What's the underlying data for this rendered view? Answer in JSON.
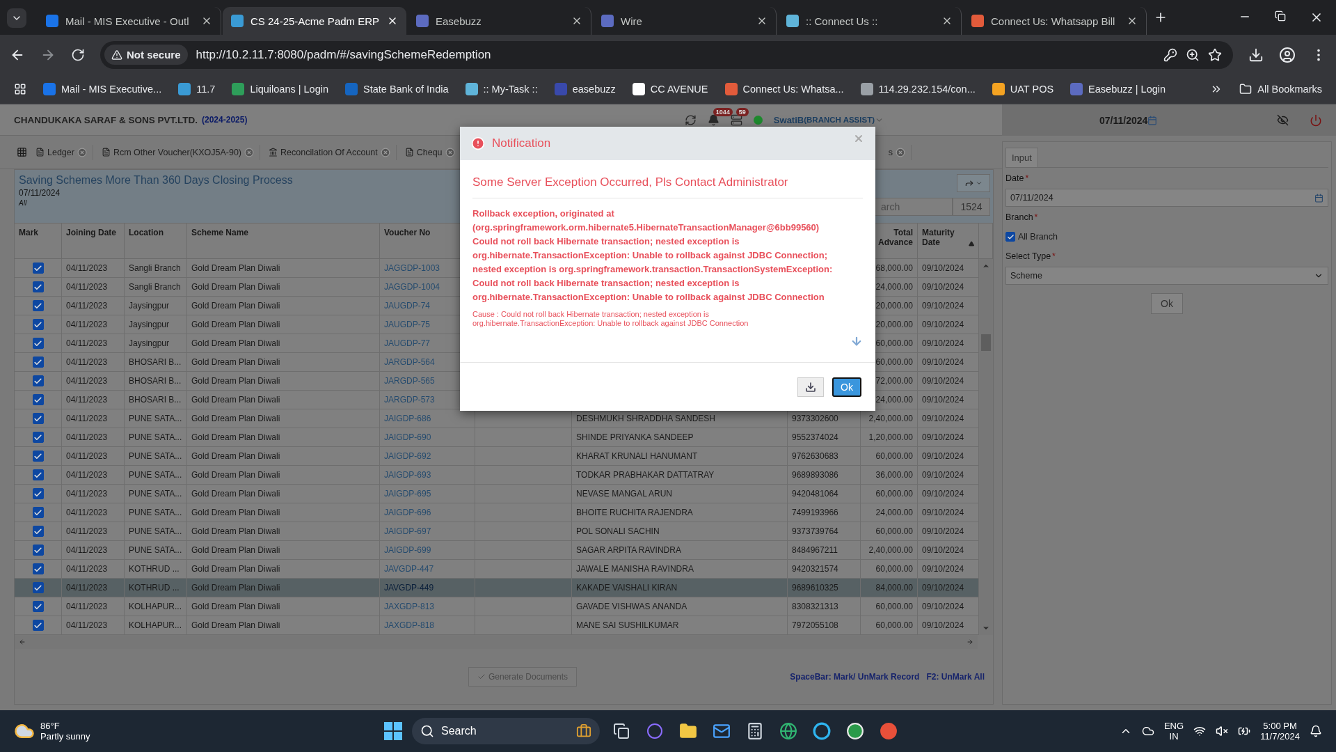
{
  "browser": {
    "tabs": [
      {
        "title": "Mail - MIS Executive - Outl",
        "selected": false
      },
      {
        "title": "CS 24-25-Acme Padm ERP",
        "selected": true
      },
      {
        "title": "Easebuzz",
        "selected": false
      },
      {
        "title": "Wire",
        "selected": false
      },
      {
        "title": ":: Connect Us ::",
        "selected": false
      },
      {
        "title": "Connect Us: Whatsapp Bill",
        "selected": false
      }
    ],
    "security": "Not secure",
    "url": "http://10.2.11.7:8080/padm/#/savingSchemeRedemption",
    "bookmarks": [
      {
        "label": "Mail - MIS Executive...",
        "color": "#1a73e8"
      },
      {
        "label": "11.7",
        "color": "#3a9bd5"
      },
      {
        "label": "Liquiloans | Login",
        "color": "#2e9e5a"
      },
      {
        "label": "State Bank of India",
        "color": "#1565c0"
      },
      {
        "label": ":: My-Task ::",
        "color": "#5fb4d9"
      },
      {
        "label": "easebuzz",
        "color": "#3949ab"
      },
      {
        "label": "CC AVENUE",
        "color": "#ffffff"
      },
      {
        "label": "Connect Us: Whatsa...",
        "color": "#e25b3b"
      },
      {
        "label": "114.29.232.154/con...",
        "color": "#9aa0a6"
      },
      {
        "label": "UAT POS",
        "color": "#f4a322"
      },
      {
        "label": "Easebuzz | Login",
        "color": "#5c6bc0"
      }
    ],
    "all_bookmarks": "All Bookmarks"
  },
  "header": {
    "company": "CHANDUKAKA SARAF & SONS PVT.LTD.",
    "year": "(2024-2025)",
    "notifications": "1044",
    "messages": "59",
    "user": "SwatiB",
    "role": "(BRANCH ASSIST)",
    "date": "07/11/2024"
  },
  "tabs": [
    {
      "label": "Ledger"
    },
    {
      "label": "Rcm Other Voucher(KXOJ5A-90)"
    },
    {
      "label": "Reconcilation Of Account"
    },
    {
      "label": "Chequ"
    },
    {
      "label": "s"
    }
  ],
  "panel": {
    "title": "Saving Schemes More Than 360 Days Closing Process",
    "date": "07/11/2024",
    "filter": "All",
    "search_placeholder": "arch",
    "count": "1524"
  },
  "table": {
    "columns": [
      "Mark",
      "Joining Date",
      "Location",
      "Scheme Name",
      "Voucher No",
      "Total Advance",
      "Maturity Date"
    ],
    "rows": [
      {
        "date": "04/11/2023",
        "location": "Sangli Branch",
        "scheme": "Gold Dream Plan Diwali",
        "voucher": "JAGGDP-1003",
        "advance": "68,000.00",
        "maturity": "09/10/2024",
        "checked": true,
        "selected": false
      },
      {
        "date": "04/11/2023",
        "location": "Sangli Branch",
        "scheme": "Gold Dream Plan Diwali",
        "voucher": "JAGGDP-1004",
        "advance": "24,000.00",
        "maturity": "09/10/2024",
        "checked": true,
        "selected": false
      },
      {
        "date": "04/11/2023",
        "location": "Jaysingpur",
        "scheme": "Gold Dream Plan Diwali",
        "voucher": "JAUGDP-74",
        "advance": "20,000.00",
        "maturity": "09/10/2024",
        "checked": true,
        "selected": false
      },
      {
        "date": "04/11/2023",
        "location": "Jaysingpur",
        "scheme": "Gold Dream Plan Diwali",
        "voucher": "JAUGDP-75",
        "advance": "20,000.00",
        "maturity": "09/10/2024",
        "checked": true,
        "selected": false
      },
      {
        "date": "04/11/2023",
        "location": "Jaysingpur",
        "scheme": "Gold Dream Plan Diwali",
        "voucher": "JAUGDP-77",
        "advance": "60,000.00",
        "maturity": "09/10/2024",
        "checked": true,
        "selected": false
      },
      {
        "date": "04/11/2023",
        "location": "BHOSARI B...",
        "scheme": "Gold Dream Plan Diwali",
        "voucher": "JARGDP-564",
        "advance": "60,000.00",
        "maturity": "09/10/2024",
        "checked": true,
        "selected": false
      },
      {
        "date": "04/11/2023",
        "location": "BHOSARI B...",
        "scheme": "Gold Dream Plan Diwali",
        "voucher": "JARGDP-565",
        "advance": "72,000.00",
        "maturity": "09/10/2024",
        "checked": true,
        "selected": false
      },
      {
        "date": "04/11/2023",
        "location": "BHOSARI B...",
        "scheme": "Gold Dream Plan Diwali",
        "voucher": "JARGDP-573",
        "advance": "24,000.00",
        "maturity": "09/10/2024",
        "checked": true,
        "selected": false
      },
      {
        "date": "04/11/2023",
        "location": "PUNE SATA...",
        "scheme": "Gold Dream Plan Diwali",
        "voucher": "JAIGDP-686",
        "name": "DESHMUKH SHRADDHA SANDESH",
        "mobile": "9373302600",
        "advance": "2,40,000.00",
        "maturity": "09/10/2024",
        "checked": true,
        "selected": false
      },
      {
        "date": "04/11/2023",
        "location": "PUNE SATA...",
        "scheme": "Gold Dream Plan Diwali",
        "voucher": "JAIGDP-690",
        "name": "SHINDE PRIYANKA SANDEEP",
        "mobile": "9552374024",
        "advance": "1,20,000.00",
        "maturity": "09/10/2024",
        "checked": true,
        "selected": false
      },
      {
        "date": "04/11/2023",
        "location": "PUNE SATA...",
        "scheme": "Gold Dream Plan Diwali",
        "voucher": "JAIGDP-692",
        "name": "KHARAT KRUNALI HANUMANT",
        "mobile": "9762630683",
        "advance": "60,000.00",
        "maturity": "09/10/2024",
        "checked": true,
        "selected": false
      },
      {
        "date": "04/11/2023",
        "location": "PUNE SATA...",
        "scheme": "Gold Dream Plan Diwali",
        "voucher": "JAIGDP-693",
        "name": "TODKAR PRABHAKAR DATTATRAY",
        "mobile": "9689893086",
        "advance": "36,000.00",
        "maturity": "09/10/2024",
        "checked": true,
        "selected": false
      },
      {
        "date": "04/11/2023",
        "location": "PUNE SATA...",
        "scheme": "Gold Dream Plan Diwali",
        "voucher": "JAIGDP-695",
        "name": "NEVASE MANGAL ARUN",
        "mobile": "9420481064",
        "advance": "60,000.00",
        "maturity": "09/10/2024",
        "checked": true,
        "selected": false
      },
      {
        "date": "04/11/2023",
        "location": "PUNE SATA...",
        "scheme": "Gold Dream Plan Diwali",
        "voucher": "JAIGDP-696",
        "name": "BHOITE RUCHITA RAJENDRA",
        "mobile": "7499193966",
        "advance": "24,000.00",
        "maturity": "09/10/2024",
        "checked": true,
        "selected": false
      },
      {
        "date": "04/11/2023",
        "location": "PUNE SATA...",
        "scheme": "Gold Dream Plan Diwali",
        "voucher": "JAIGDP-697",
        "name": "POL SONALI SACHIN",
        "mobile": "9373739764",
        "advance": "60,000.00",
        "maturity": "09/10/2024",
        "checked": true,
        "selected": false
      },
      {
        "date": "04/11/2023",
        "location": "PUNE SATA...",
        "scheme": "Gold Dream Plan Diwali",
        "voucher": "JAIGDP-699",
        "name": "SAGAR ARPITA RAVINDRA",
        "mobile": "8484967211",
        "advance": "2,40,000.00",
        "maturity": "09/10/2024",
        "checked": true,
        "selected": false
      },
      {
        "date": "04/11/2023",
        "location": "KOTHRUD ...",
        "scheme": "Gold Dream Plan Diwali",
        "voucher": "JAVGDP-447",
        "name": "JAWALE MANISHA RAVINDRA",
        "mobile": "9420321574",
        "advance": "60,000.00",
        "maturity": "09/10/2024",
        "checked": true,
        "selected": false
      },
      {
        "date": "04/11/2023",
        "location": "KOTHRUD ...",
        "scheme": "Gold Dream Plan Diwali",
        "voucher": "JAVGDP-449",
        "name": "KAKADE VAISHALI KIRAN",
        "mobile": "9689610325",
        "advance": "84,000.00",
        "maturity": "09/10/2024",
        "checked": true,
        "selected": true
      },
      {
        "date": "04/11/2023",
        "location": "KOLHAPUR...",
        "scheme": "Gold Dream Plan Diwali",
        "voucher": "JAXGDP-813",
        "name": "GAVADE VISHWAS ANANDA",
        "mobile": "8308321313",
        "advance": "60,000.00",
        "maturity": "09/10/2024",
        "checked": true,
        "selected": false
      },
      {
        "date": "04/11/2023",
        "location": "KOLHAPUR...",
        "scheme": "Gold Dream Plan Diwali",
        "voucher": "JAXGDP-818",
        "name": "MANE SAI SUSHILKUMAR",
        "mobile": "7972055108",
        "advance": "60,000.00",
        "maturity": "09/10/2024",
        "checked": true,
        "selected": false
      }
    ]
  },
  "footer": {
    "generate": {
      "label": "Generate Documents",
      "disabled": true
    },
    "hint_mark": "SpaceBar: Mark/ UnMark Record",
    "hint_unmark": "F2: UnMark All"
  },
  "input_panel": {
    "tab": "Input",
    "date": {
      "label": "Date",
      "required": "*",
      "value": "07/11/2024"
    },
    "branch": {
      "label": "Branch",
      "required": "*"
    },
    "all_branch": {
      "label": "All Branch",
      "checked": true
    },
    "type": {
      "label": "Select Type",
      "required": "*",
      "value": "Scheme"
    },
    "ok": "Ok"
  },
  "dialog": {
    "title": "Notification",
    "heading": "Some Server Exception Occurred, Pls Contact Administrator",
    "message": "Rollback exception, originated at\n(org.springframework.orm.hibernate5.HibernateTransactionManager@6bb99560)\nCould not roll back Hibernate transaction; nested exception is\norg.hibernate.TransactionException: Unable to rollback against JDBC Connection;\nnested exception is org.springframework.transaction.TransactionSystemException:\nCould not roll back Hibernate transaction; nested exception is\norg.hibernate.TransactionException: Unable to rollback against JDBC Connection",
    "cause": "Cause : Could not roll back Hibernate transaction; nested exception is\norg.hibernate.TransactionException: Unable to rollback against JDBC Connection",
    "ok": "Ok"
  },
  "taskbar": {
    "temperature": "86°F",
    "weather": "Partly sunny",
    "search": "Search",
    "language": "ENG",
    "region": "IN",
    "time": "5:00 PM",
    "date": "11/7/2024"
  }
}
